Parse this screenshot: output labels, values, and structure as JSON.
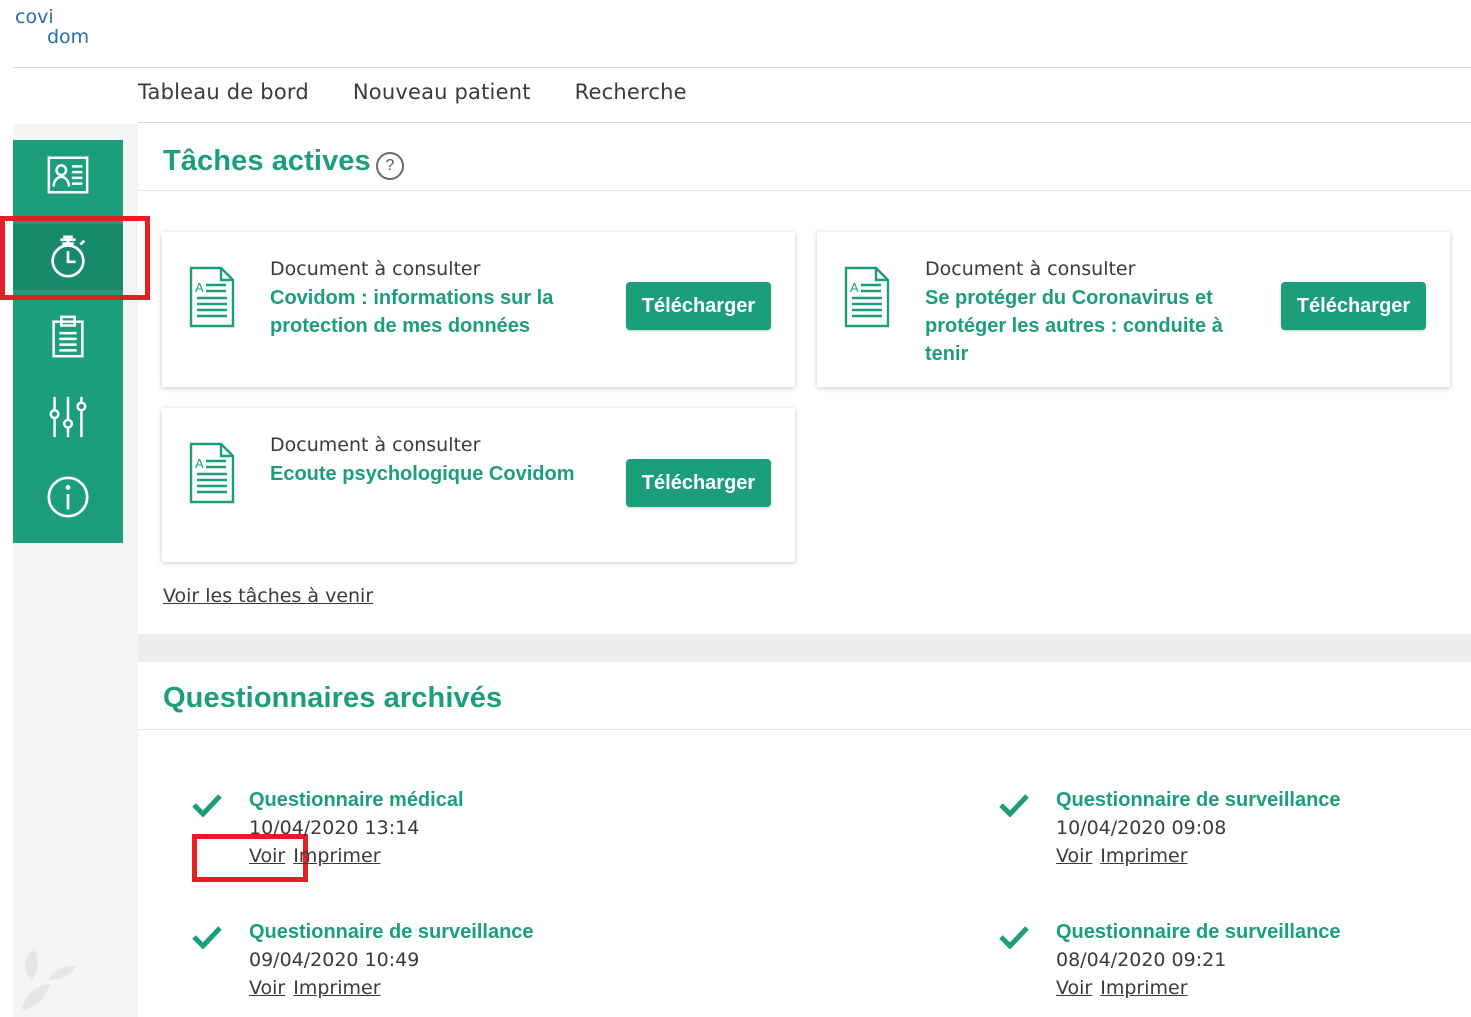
{
  "brand": {
    "line1": "covi",
    "line2": "dom"
  },
  "topnav": {
    "items": [
      {
        "label": "Tableau de bord"
      },
      {
        "label": "Nouveau patient"
      },
      {
        "label": "Recherche"
      }
    ]
  },
  "sidebar": {
    "items": [
      {
        "icon": "patient-card-icon"
      },
      {
        "icon": "stopwatch-icon",
        "active": true
      },
      {
        "icon": "clipboard-icon"
      },
      {
        "icon": "sliders-icon"
      },
      {
        "icon": "info-icon"
      }
    ]
  },
  "tasks": {
    "title": "Tâches actives",
    "help_glyph": "?",
    "cards": [
      {
        "kind": "Document à consulter",
        "title": "Covidom : informations sur la protection de mes données",
        "button": "Télécharger"
      },
      {
        "kind": "Document à consulter",
        "title": "Se protéger du Coronavirus et protéger les autres : conduite à tenir",
        "button": "Télécharger"
      },
      {
        "kind": "Document à consulter",
        "title": "Ecoute psychologique Covidom",
        "button": "Télécharger"
      }
    ],
    "upcoming_link": "Voir les tâches à venir"
  },
  "archived": {
    "title": "Questionnaires archivés",
    "items": [
      {
        "name": "Questionnaire médical",
        "date": "10/04/2020 13:14",
        "view": "Voir",
        "print": "Imprimer"
      },
      {
        "name": "Questionnaire de surveillance",
        "date": "10/04/2020 09:08",
        "view": "Voir",
        "print": "Imprimer"
      },
      {
        "name": "Questionnaire de surveillance",
        "date": "09/04/2020 10:49",
        "view": "Voir",
        "print": "Imprimer"
      },
      {
        "name": "Questionnaire de surveillance",
        "date": "08/04/2020 09:21",
        "view": "Voir",
        "print": "Imprimer"
      }
    ]
  },
  "colors": {
    "accent": "#1c9e7a",
    "accent_dark": "#178a6a",
    "highlight": "#e31f26",
    "logo": "#2a6db0"
  }
}
